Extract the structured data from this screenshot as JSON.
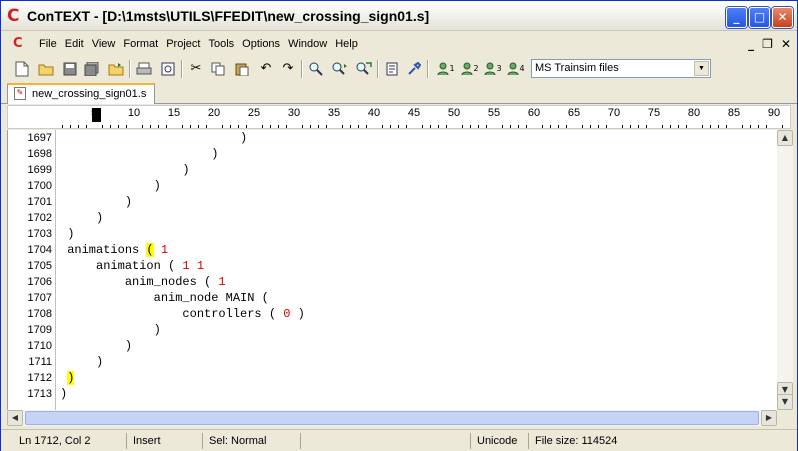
{
  "window": {
    "title": "ConTEXT - [D:\\1msts\\UTILS\\FFEDIT\\new_crossing_sign01.s]",
    "logo_letter": "C",
    "minimize": "_",
    "maximize": "□",
    "close": "✕"
  },
  "menu": {
    "items": [
      "File",
      "Edit",
      "View",
      "Format",
      "Project",
      "Tools",
      "Options",
      "Window",
      "Help"
    ],
    "mdi_minimize": "_",
    "mdi_restore": "❐",
    "mdi_close": "✕"
  },
  "toolbar": {
    "filetype_value": "MS Trainsim files",
    "user_cmd_numbers": [
      "1",
      "2",
      "3",
      "4"
    ]
  },
  "tabs": {
    "active_tab": "new_crossing_sign01.s"
  },
  "ruler": {
    "labels": [
      "5",
      "10",
      "15",
      "20",
      "25",
      "30",
      "35",
      "40",
      "45",
      "50",
      "55",
      "60",
      "65",
      "70",
      "75",
      "80",
      "85",
      "90"
    ]
  },
  "editor": {
    "line_numbers": [
      "1697",
      "1698",
      "1699",
      "1700",
      "1701",
      "1702",
      "1703",
      "1704",
      "1705",
      "1706",
      "1707",
      "1708",
      "1709",
      "1710",
      "1711",
      "1712",
      "1713"
    ],
    "lines": [
      {
        "indent": "                         ",
        "text": ")"
      },
      {
        "indent": "                     ",
        "text": ")"
      },
      {
        "indent": "                 ",
        "text": ")"
      },
      {
        "indent": "             ",
        "text": ")"
      },
      {
        "indent": "         ",
        "text": ")"
      },
      {
        "indent": "     ",
        "text": ")"
      },
      {
        "indent": " ",
        "text": ")"
      },
      {
        "indent": " ",
        "keyword": "animations ",
        "paren": "(",
        "args": " 1"
      },
      {
        "indent": "     ",
        "keyword": "animation ",
        "paren": "(",
        "args": " 1 1"
      },
      {
        "indent": "         ",
        "keyword": "anim_nodes ",
        "paren": "(",
        "args": " 1"
      },
      {
        "indent": "             ",
        "keyword": "anim_node MAIN ",
        "paren": "(",
        "args": ""
      },
      {
        "indent": "                 ",
        "keyword": "controllers ",
        "paren": "(",
        "args": " 0 )"
      },
      {
        "indent": "             ",
        "text": ")"
      },
      {
        "indent": "         ",
        "text": ")"
      },
      {
        "indent": "     ",
        "text": ")"
      },
      {
        "indent": " ",
        "text": ")"
      },
      {
        "indent": "",
        "text": ")"
      }
    ]
  },
  "status": {
    "position": "Ln 1712, Col 2",
    "mode": "Insert",
    "selection": "Sel: Normal",
    "empty": "",
    "encoding": "Unicode",
    "filesize": "File size: 114524"
  }
}
